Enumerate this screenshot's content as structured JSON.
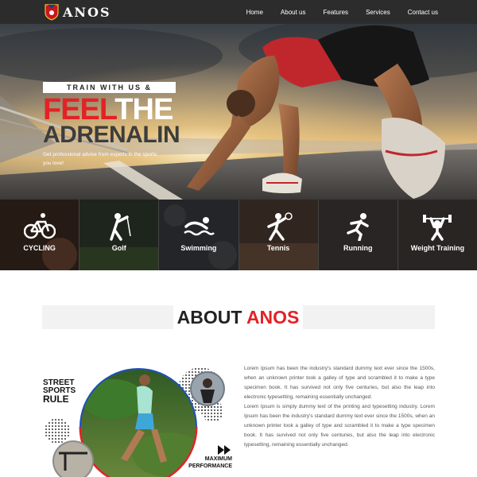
{
  "brand": {
    "name": "ANOS"
  },
  "nav": {
    "items": [
      "Home",
      "About us",
      "Features",
      "Services",
      "Contact us"
    ]
  },
  "hero": {
    "kicker": "TRAIN WITH US &",
    "headline_red": "FEEL",
    "headline_white": "THE",
    "headline_line2": "ADRENALIN",
    "subtext": "Get professional advise from experts in the sports you love!",
    "slides": 2,
    "active_slide": 1
  },
  "sports": [
    {
      "label": "CYCLING",
      "icon": "bicycle-icon"
    },
    {
      "label": "Golf",
      "icon": "golfer-icon"
    },
    {
      "label": "Swimming",
      "icon": "swimmer-icon"
    },
    {
      "label": "Tennis",
      "icon": "tennis-player-icon"
    },
    {
      "label": "Running",
      "icon": "runner-icon"
    },
    {
      "label": "Weight Training",
      "icon": "weightlifter-icon"
    }
  ],
  "about": {
    "title_dark": "ABOUT",
    "title_red": "ANOS",
    "image_caption_top": "STREET SPORTS RULE",
    "image_caption_bottom": "MAXIMUM PERFORMANCE",
    "paragraph1": "Lorem Ipsum has been the industry's standard dummy text ever since the 1500s, when an unknown printer took a galley of type and scrambled it to make a type specimen book. It has survived not only five centuries, but also the leap into electronic typesetting, remaining essentially unchanged.",
    "paragraph2": "Lorem Ipsum is simply dummy text of the printing and typesetting industry. Lorem Ipsum has been the industry's standard dummy text ever since the 1500s, when an unknown printer took a galley of type and scrambled it to make a type specimen book. It has survived not only five centuries, but also the leap into electronic typesetting, remaining essentially unchanged."
  },
  "colors": {
    "accent": "#e32226",
    "nav_bg": "#2c2c2c",
    "heading_dark": "#222222"
  }
}
